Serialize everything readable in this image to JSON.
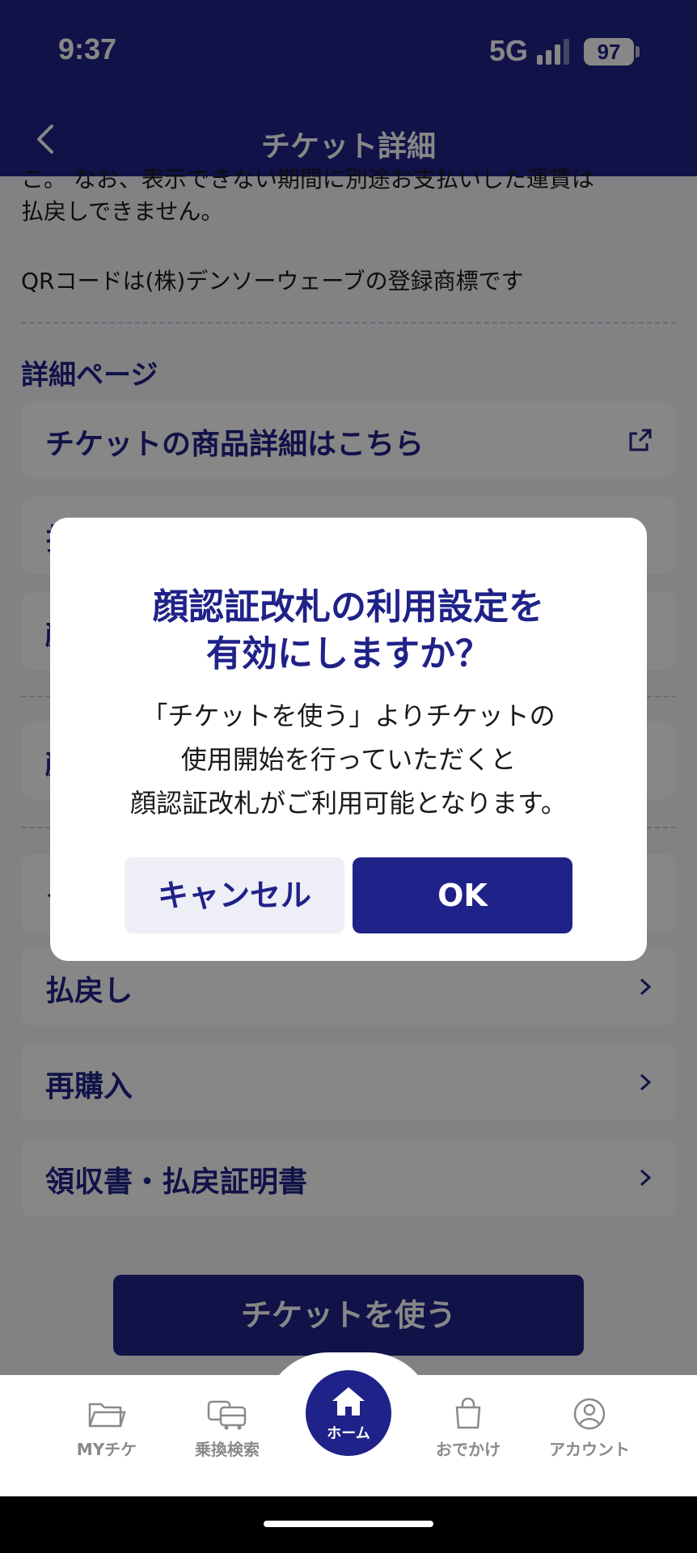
{
  "status_bar": {
    "time": "9:37",
    "network": "5G",
    "battery": "97"
  },
  "header": {
    "title": "チケット詳細"
  },
  "content": {
    "text_partial": "こ。 なお、表示できない期間に別途お支払いした運賃は",
    "text_line1": "払戻しできません。",
    "text_line2": "QRコードは(株)デンソーウェーブの登録商標です",
    "section_title": "詳細ページ",
    "rows": [
      {
        "label": "チケットの商品詳細はこちら"
      },
      {
        "label": "払"
      },
      {
        "label": "顔"
      },
      {
        "label": "顔"
      },
      {
        "label": "ク"
      },
      {
        "label": "払戻し"
      },
      {
        "label": "再購入"
      },
      {
        "label": "領収書・払戻証明書"
      }
    ],
    "use_button": "チケットを使う"
  },
  "dialog": {
    "title_line1": "顔認証改札の利用設定を",
    "title_line2": "有効にしますか？",
    "message_line1": "「チケットを使う」よりチケットの",
    "message_line2": "使用開始を行っていただくと",
    "message_line3": "顔認証改札がご利用可能となります。",
    "cancel_label": "キャンセル",
    "ok_label": "OK"
  },
  "tabbar": {
    "tabs": [
      {
        "label": "MYチケ",
        "icon": "folder-icon"
      },
      {
        "label": "乗換検索",
        "icon": "train-icon"
      },
      {
        "label": "ホーム",
        "icon": "home-icon"
      },
      {
        "label": "おでかけ",
        "icon": "bag-icon"
      },
      {
        "label": "アカウント",
        "icon": "account-icon"
      }
    ]
  },
  "colors": {
    "primary": "#1f2288",
    "background": "#f6f6fa",
    "overlay": "rgba(0,0,0,0.47)"
  }
}
